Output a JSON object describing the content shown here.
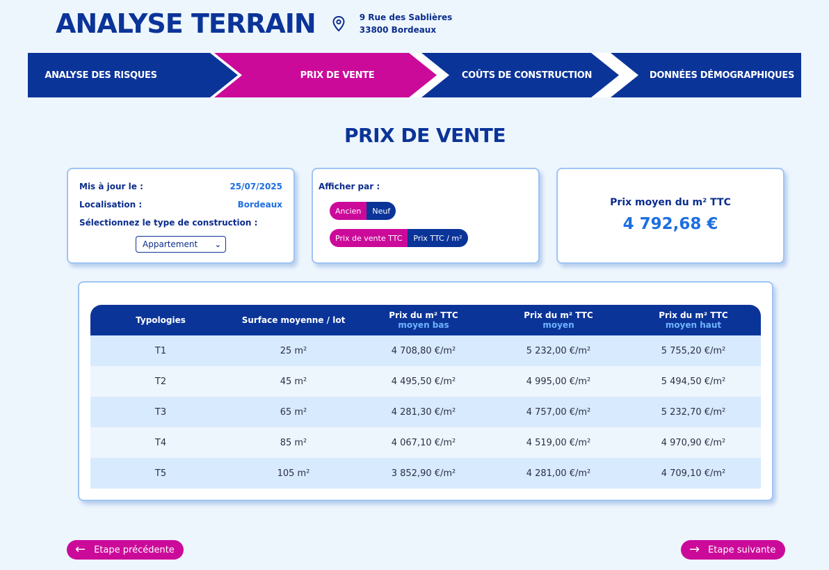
{
  "header": {
    "title": "ANALYSE TERRAIN",
    "address_line1": "9 Rue des Sablières",
    "address_line2": "33800 Bordeaux"
  },
  "steps": [
    {
      "label": "ANALYSE DES RISQUES",
      "state": "inactive"
    },
    {
      "label": "PRIX DE VENTE",
      "state": "active"
    },
    {
      "label": "COÛTS DE CONSTRUCTION",
      "state": "inactive"
    },
    {
      "label": "DONNÉES DÉMOGRAPHIQUES",
      "state": "inactive"
    }
  ],
  "section_title": "PRIX DE VENTE",
  "info_card": {
    "updated_label": "Mis à jour le :",
    "updated_value": "25/07/2025",
    "location_label": "Localisation :",
    "location_value": "Bordeaux",
    "construction_label": "Sélectionnez le type de construction :",
    "construction_selected": "Appartement"
  },
  "display_card": {
    "label": "Afficher par :",
    "toggle1": [
      "Ancien",
      "Neuf"
    ],
    "toggle2": [
      "Prix de vente TTC",
      "Prix TTC / m²"
    ]
  },
  "price_card": {
    "label": "Prix moyen du m² TTC",
    "value": "4 792,68 €"
  },
  "table": {
    "headers": [
      {
        "main": "Typologies",
        "sub": ""
      },
      {
        "main": "Surface moyenne / lot",
        "sub": ""
      },
      {
        "main": "Prix du m² TTC",
        "sub": "moyen bas"
      },
      {
        "main": "Prix du m² TTC",
        "sub": "moyen"
      },
      {
        "main": "Prix du m² TTC",
        "sub": "moyen haut"
      }
    ],
    "rows": [
      [
        "T1",
        "25 m²",
        "4 708,80 €/m²",
        "5 232,00 €/m²",
        "5 755,20 €/m²"
      ],
      [
        "T2",
        "45 m²",
        "4 495,50 €/m²",
        "4 995,00 €/m²",
        "5 494,50 €/m²"
      ],
      [
        "T3",
        "65 m²",
        "4 281,30 €/m²",
        "4 757,00 €/m²",
        "5 232,70 €/m²"
      ],
      [
        "T4",
        "85 m²",
        "4 067,10 €/m²",
        "4 519,00 €/m²",
        "4 970,90 €/m²"
      ],
      [
        "T5",
        "105 m²",
        "3 852,90 €/m²",
        "4 281,00 €/m²",
        "4 709,10 €/m²"
      ]
    ]
  },
  "nav": {
    "prev_label": "Etape précédente",
    "next_label": "Etape suivante"
  },
  "colors": {
    "navy": "#0b3499",
    "magenta": "#cc0a9a",
    "accent_blue": "#1d6fe0",
    "background": "#eef6fd"
  }
}
